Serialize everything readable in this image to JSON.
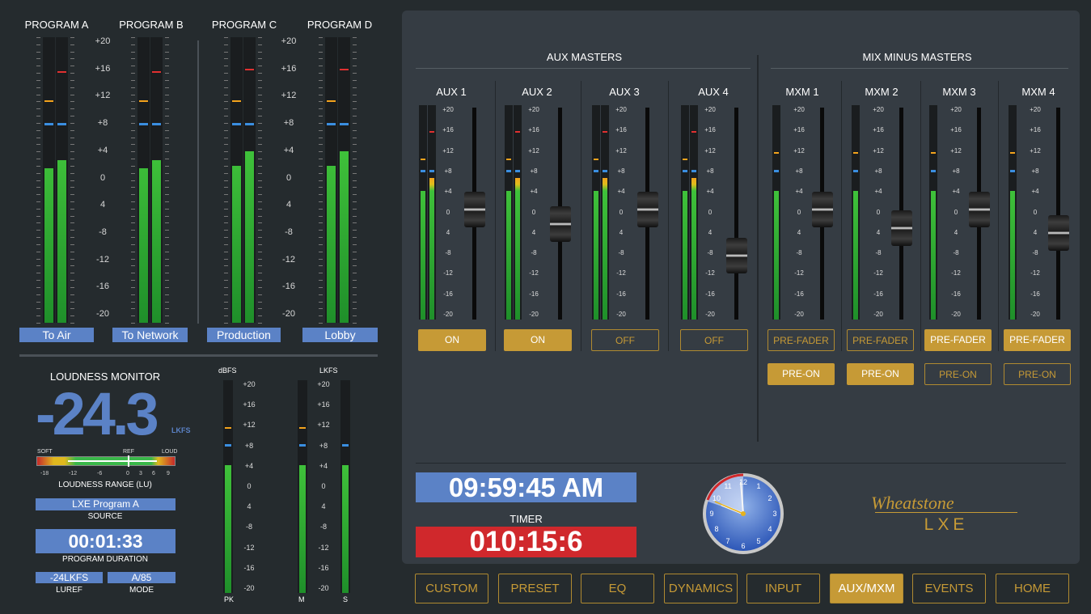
{
  "programs": [
    {
      "title": "PROGRAM A",
      "label": "To Air"
    },
    {
      "title": "PROGRAM B",
      "label": "To Network"
    },
    {
      "title": "PROGRAM C",
      "label": "Production"
    },
    {
      "title": "PROGRAM D",
      "label": "Lobby"
    }
  ],
  "meter_scale": [
    "+20",
    "+16",
    "+12",
    "+8",
    "+4",
    "0",
    "4",
    "-8",
    "-12",
    "-16",
    "-20"
  ],
  "loudness": {
    "title": "LOUDNESS MONITOR",
    "value": "-24.3",
    "unit": "LKFS",
    "range_labels": {
      "soft": "SOFT",
      "ref": "REF",
      "loud": "LOUD"
    },
    "range_ticks": [
      "-18",
      "-12",
      "-6",
      "0",
      "3",
      "6",
      "9"
    ],
    "range_title": "LOUDNESS RANGE (LU)",
    "source_value": "LXE Program A",
    "source_label": "SOURCE",
    "duration_value": "00:01:33",
    "duration_label": "PROGRAM DURATION",
    "luref_value": "-24LKFS",
    "luref_label": "LUREF",
    "mode_value": "A/85",
    "mode_label": "MODE",
    "dbfs_label": "dBFS",
    "lkfs_label": "LKFS",
    "pk_label": "PK",
    "m_label": "M",
    "s_label": "S"
  },
  "aux_masters": {
    "title": "AUX MASTERS",
    "channels": [
      {
        "name": "AUX 1",
        "state": "ON",
        "fader": 0.52
      },
      {
        "name": "AUX 2",
        "state": "ON",
        "fader": 0.45
      },
      {
        "name": "AUX 3",
        "state": "OFF",
        "fader": 0.52
      },
      {
        "name": "AUX 4",
        "state": "OFF",
        "fader": 0.3
      }
    ]
  },
  "mix_minus_masters": {
    "title": "MIX MINUS MASTERS",
    "channels": [
      {
        "name": "MXM 1",
        "fader_btn": "PRE-FADER",
        "fader_active": false,
        "on_btn": "PRE-ON",
        "on_active": true,
        "fader": 0.52
      },
      {
        "name": "MXM 2",
        "fader_btn": "PRE-FADER",
        "fader_active": false,
        "on_btn": "PRE-ON",
        "on_active": true,
        "fader": 0.43
      },
      {
        "name": "MXM 3",
        "fader_btn": "PRE-FADER",
        "fader_active": true,
        "on_btn": "PRE-ON",
        "on_active": false,
        "fader": 0.52
      },
      {
        "name": "MXM 4",
        "fader_btn": "PRE-FADER",
        "fader_active": true,
        "on_btn": "PRE-ON",
        "on_active": false,
        "fader": 0.41
      }
    ]
  },
  "aux_scale": [
    "+20",
    "+16",
    "+12",
    "+8",
    "+4",
    "0",
    "4",
    "-8",
    "-12",
    "-16",
    "-20"
  ],
  "clock": {
    "time": "09:59:45 AM",
    "timer_label": "TIMER",
    "timer_value": "010:15:6"
  },
  "brand": {
    "name": "Wheatstone",
    "model": "LXE"
  },
  "nav": [
    "CUSTOM",
    "PRESET",
    "EQ",
    "DYNAMICS",
    "INPUT",
    "AUX/MXM",
    "EVENTS",
    "HOME"
  ],
  "nav_active": "AUX/MXM",
  "colors": {
    "accent": "#c69a36",
    "blue_label": "#5b82c6",
    "timer_red": "#d0282c",
    "panel": "#353c43",
    "bg": "#252b2e"
  }
}
